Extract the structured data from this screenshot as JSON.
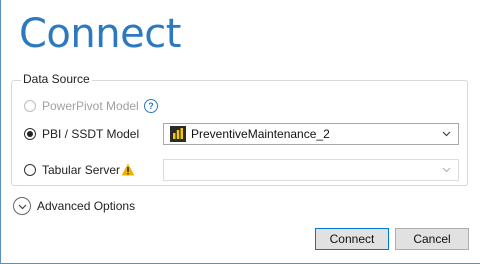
{
  "dialog": {
    "title": "Connect"
  },
  "data_source": {
    "group_label": "Data Source",
    "options": [
      {
        "label": "PowerPivot Model",
        "selected": false,
        "enabled": false,
        "icon": "help-icon"
      },
      {
        "label": "PBI / SSDT Model",
        "selected": true,
        "enabled": true
      },
      {
        "label": "Tabular Server",
        "selected": false,
        "enabled": true,
        "icon": "warning-icon"
      }
    ],
    "pbi_model_select": {
      "value": "PreventiveMaintenance_2",
      "icon": "pbi-icon"
    },
    "tabular_server_select": {
      "value": ""
    },
    "help_glyph": "?"
  },
  "advanced_options": {
    "label": "Advanced Options"
  },
  "buttons": {
    "connect": "Connect",
    "cancel": "Cancel"
  },
  "colors": {
    "accent": "#2d79c0",
    "warning": "#f0b400",
    "pbi_icon": "#f2c811"
  }
}
